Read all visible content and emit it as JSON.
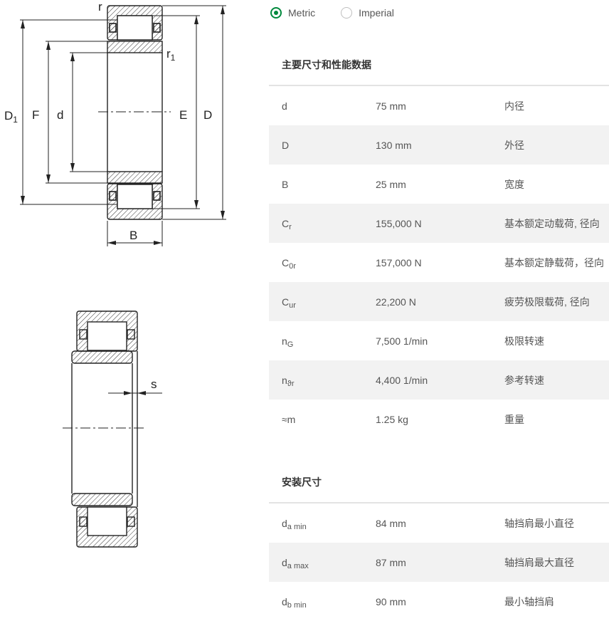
{
  "unit_toggle": {
    "metric_label": "Metric",
    "imperial_label": "Imperial",
    "selected": "Metric",
    "accent_color": "#00893d"
  },
  "drawing_labels": {
    "r": "r",
    "r1": "r",
    "r1_sub": "1",
    "D1": "D",
    "D1_sub": "1",
    "F": "F",
    "d": "d",
    "E": "E",
    "D": "D",
    "B": "B",
    "s": "s"
  },
  "main_dimensions": {
    "title": "主要尺寸和性能数据",
    "rows": [
      {
        "symbol": "d",
        "sub": "",
        "value": "75 mm",
        "desc": "内径"
      },
      {
        "symbol": "D",
        "sub": "",
        "value": "130 mm",
        "desc": "外径"
      },
      {
        "symbol": "B",
        "sub": "",
        "value": "25 mm",
        "desc": "宽度"
      },
      {
        "symbol": "C",
        "sub": "r",
        "value": "155,000 N",
        "desc": "基本额定动载荷, 径向"
      },
      {
        "symbol": "C",
        "sub": "0r",
        "value": "157,000 N",
        "desc": "基本额定静载荷，径向"
      },
      {
        "symbol": "C",
        "sub": "ur",
        "value": "22,200 N",
        "desc": "疲劳极限载荷, 径向"
      },
      {
        "symbol": "n",
        "sub": "G",
        "value": "7,500 1/min",
        "desc": "极限转速"
      },
      {
        "symbol": "n",
        "sub": "ϑr",
        "value": "4,400 1/min",
        "desc": "参考转速"
      },
      {
        "symbol": "≈m",
        "sub": "",
        "value": "1.25 kg",
        "desc": "重量"
      }
    ]
  },
  "mounting_dimensions": {
    "title": "安装尺寸",
    "rows": [
      {
        "symbol": "d",
        "sub": "a min",
        "value": "84 mm",
        "desc": "轴挡肩最小直径"
      },
      {
        "symbol": "d",
        "sub": "a max",
        "value": "87 mm",
        "desc": "轴挡肩最大直径"
      },
      {
        "symbol": "d",
        "sub": "b min",
        "value": "90 mm",
        "desc": "最小轴挡肩"
      }
    ]
  }
}
